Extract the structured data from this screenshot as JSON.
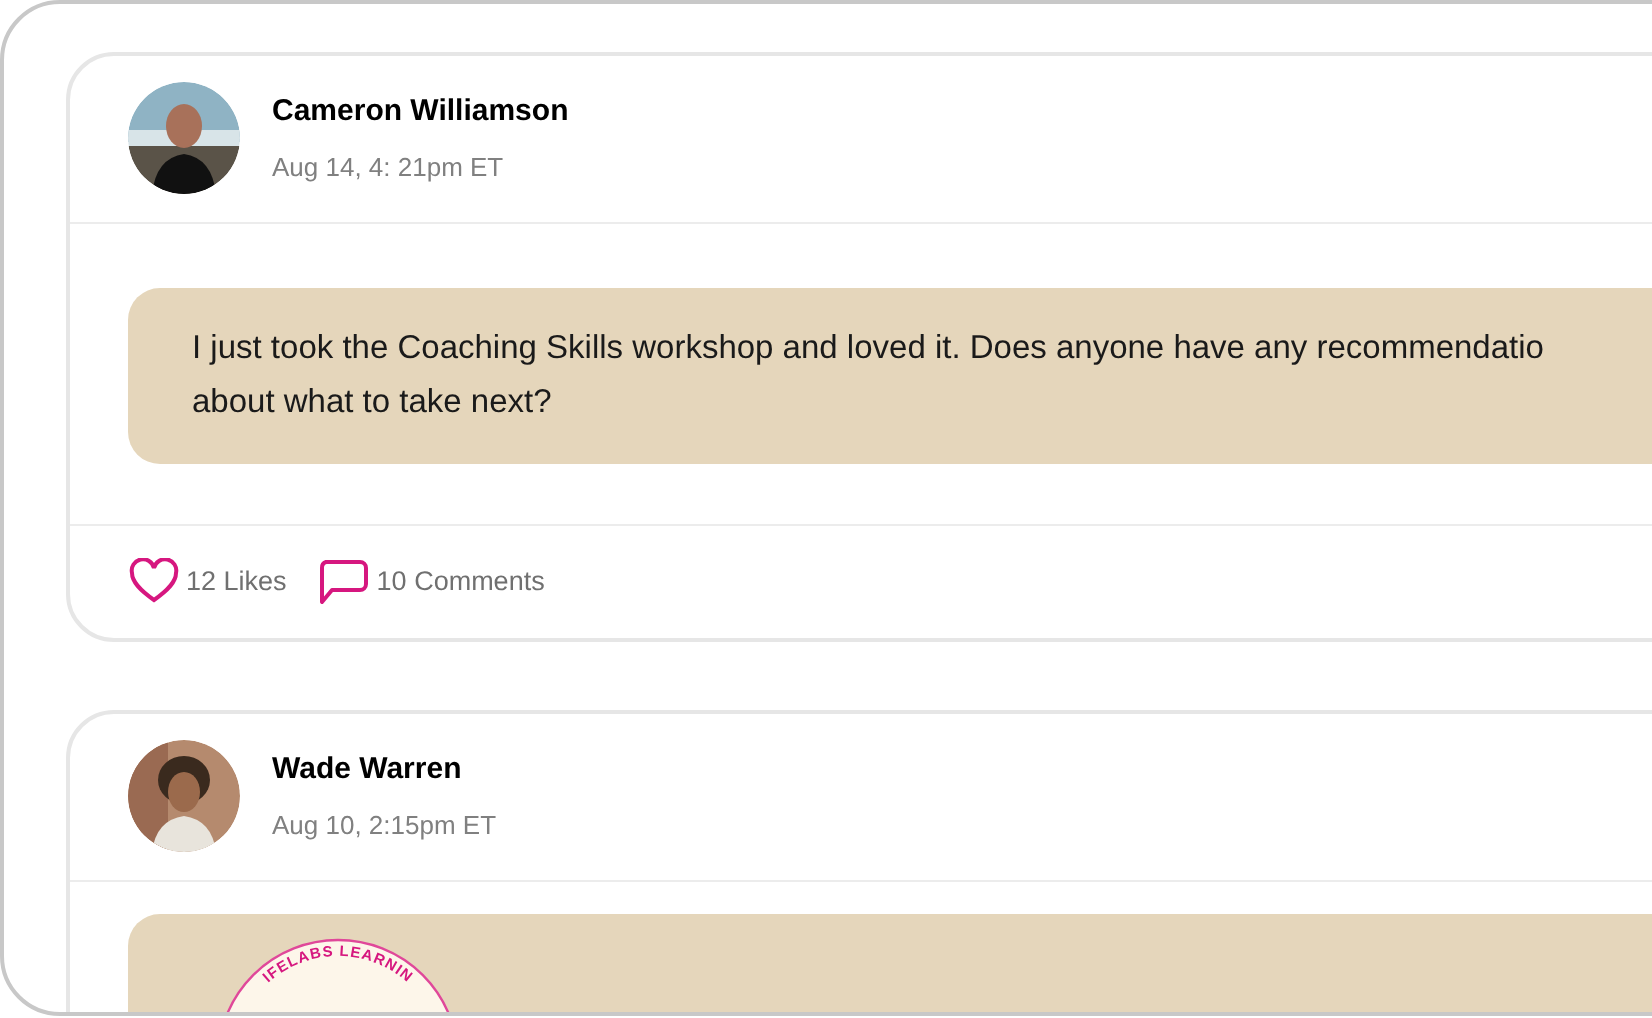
{
  "posts": [
    {
      "author": "Cameron Williamson",
      "time": "Aug 14, 4: 21pm ET",
      "message_lines": [
        "I just took the Coaching Skills workshop and loved it. Does anyone have any recommendatio",
        "about what to take next?"
      ],
      "likes": "12 Likes",
      "comments": "10 Comments"
    },
    {
      "author": "Wade Warren",
      "time": "Aug 10, 2:15pm ET",
      "badge": "IFELABS LEARNIN"
    }
  ]
}
